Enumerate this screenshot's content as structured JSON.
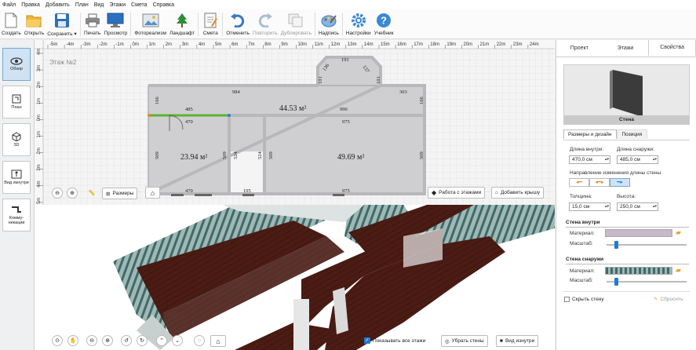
{
  "menu": [
    "Файл",
    "Правка",
    "Добавить",
    "План",
    "Вид",
    "Этажи",
    "Смета",
    "Справка"
  ],
  "toolbar": {
    "create": "Создать",
    "open": "Открыть",
    "save": "Сохранить",
    "print": "Печать",
    "preview": "Просмотр",
    "photorealism": "Фотореализм",
    "landscape": "Ландшафт",
    "estimate": "Смета",
    "undo": "Отменить",
    "redo": "Повторить",
    "duplicate": "Дублировать",
    "label": "Надпись",
    "settings": "Настройки",
    "tutorial": "Учебник"
  },
  "leftbar": {
    "overview": "Обзор",
    "plan": "План",
    "view3d": "3D",
    "inside_view": "Вид изнутри",
    "communications": "Комму-никации"
  },
  "plan": {
    "floor_label": "Этаж №2",
    "ruler_top": [
      "-5m",
      "-4m",
      "-3m",
      "-2m",
      "-1m",
      "0m",
      "1m",
      "2m",
      "3m",
      "4m",
      "5m",
      "6m",
      "7m",
      "8m",
      "9m",
      "10m",
      "11m",
      "12m",
      "13m",
      "14m",
      "15m",
      "16m",
      "17m",
      "18m",
      "19m",
      "20m",
      "21m",
      "22m",
      "23m",
      "24m"
    ],
    "ruler_left": [
      "4m",
      "3m",
      "2m",
      "1m",
      "0m",
      "1m",
      "2m",
      "3m",
      "4m",
      "5m",
      "6m",
      "7m",
      "8m"
    ],
    "dims": {
      "d984": "984",
      "d303": "303",
      "d191": "191",
      "d136": "136",
      "d137": "137",
      "d101a": "101",
      "d101b": "101",
      "d485": "485",
      "d470a": "470",
      "d990": "990",
      "d975a": "975",
      "d166a": "166",
      "d166b": "166",
      "d509a": "509",
      "d509b": "509",
      "d509c": "509",
      "d509d": "509",
      "d524a": "524",
      "d524b": "524",
      "d470b": "470",
      "d195": "195",
      "d975b": "975"
    },
    "area1": "23.94 м²",
    "area2": "44.53 м²",
    "area3": "49.69 м²",
    "dimensions_btn": "Размеры",
    "floors_btn": "Работа с этажами",
    "add_roof_btn": "Добавить крышу"
  },
  "view3d": {
    "show_all_floors_label": "Показывать все этажи",
    "show_all_floors_checked": true,
    "remove_walls_btn": "Убрать стены",
    "inside_view_btn": "Вид изнутри"
  },
  "rpanel": {
    "tabs": [
      "Проект",
      "Этажи",
      "Свойства"
    ],
    "active_tab": "Свойства",
    "preview_caption": "Стена",
    "subtabs": [
      "Размеры и дизайн",
      "Позиция"
    ],
    "inner_length_label": "Длина внутри:",
    "inner_length_value": "470,0 см",
    "outer_length_label": "Длина снаружи:",
    "outer_length_value": "485,0 см",
    "direction_label": "Направление изменения длины стены:",
    "thickness_label": "Толщина:",
    "thickness_value": "15,0 см",
    "height_label": "Высота:",
    "height_value": "250,0 см",
    "wall_inside_head": "Стена внутри",
    "wall_outside_head": "Стена снаружи",
    "material_label": "Материал:",
    "scale_label": "Масштаб:",
    "hide_wall_label": "Скрыть стену",
    "reset_label": "Сбросить",
    "inside_material_color": "#c8b7c8",
    "accent_color": "#1e7bd6"
  }
}
